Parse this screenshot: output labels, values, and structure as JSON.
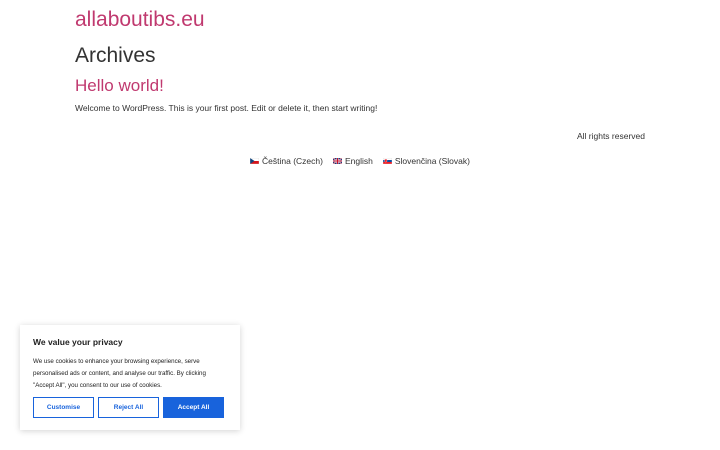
{
  "site": {
    "title": "allaboutibs.eu"
  },
  "archive": {
    "heading": "Archives"
  },
  "post": {
    "title": "Hello world!",
    "excerpt": "Welcome to WordPress. This is your first post. Edit or delete it, then start writing!"
  },
  "footer": {
    "copyright": "All rights reserved"
  },
  "languages": [
    {
      "label": "Čeština (Czech)",
      "flag": "czech-flag-icon"
    },
    {
      "label": "English",
      "flag": "uk-flag-icon"
    },
    {
      "label": "Slovenčina (Slovak)",
      "flag": "slovak-flag-icon"
    }
  ],
  "cookie_banner": {
    "title": "We value your privacy",
    "text": "We use cookies to enhance your browsing experience, serve personalised ads or content, and analyse our traffic. By clicking \"Accept All\", you consent to our use of cookies.",
    "customise_label": "Customise",
    "reject_label": "Reject All",
    "accept_label": "Accept All",
    "accent_color": "#1863dc"
  },
  "colors": {
    "link": "#c0396f",
    "text": "#333333"
  }
}
